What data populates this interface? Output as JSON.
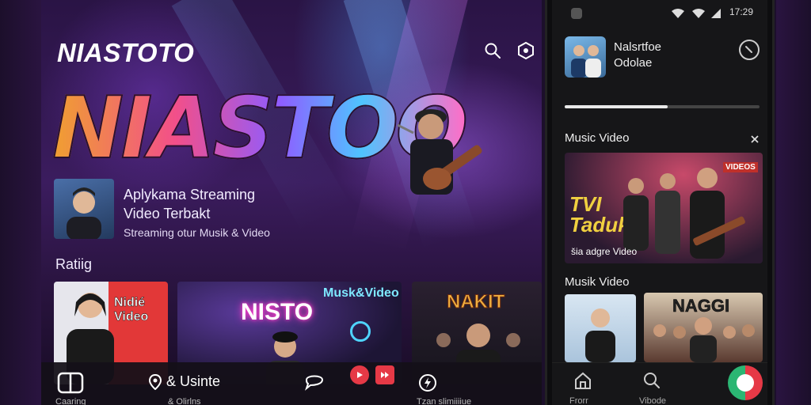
{
  "desktop": {
    "brand": "NIASTOTO",
    "hero_word": "NIASTOO",
    "promo": {
      "line1": "Aplykama Streaming",
      "line2": "Video Terbakt",
      "line3": "Streaming otur Musik & Video"
    },
    "section_label": "Ratiig",
    "cards": [
      {
        "title": "Nidié Video"
      },
      {
        "title": "NISTO",
        "tag": "Musk&Video"
      },
      {
        "title": "NAKIT"
      }
    ],
    "bottom_bar": {
      "item2_label": "& Usinte",
      "item1_sub": "Caaring",
      "item2_sub": "& Olirlns",
      "item3_sub": "Tzan slimiiiiue"
    }
  },
  "phone": {
    "status_time": "17:29",
    "header": {
      "title_line1": "Nalsrtfoe",
      "title_line2": "Odolae"
    },
    "progress": 0.53,
    "section1": {
      "label": "Music Video",
      "card_text": "TVI Taduk",
      "card_caption": "šia adgre Video",
      "card_badge": "VIDEOS"
    },
    "section2": {
      "label": "Musik Video",
      "card2_title": "NAGGI"
    },
    "nav": {
      "home": "Frorr",
      "videos": "Vibode"
    }
  },
  "colors": {
    "accent": "#e63946",
    "bg": "#1c0f2b",
    "phone_bg": "#161618",
    "green": "#2bb673"
  }
}
